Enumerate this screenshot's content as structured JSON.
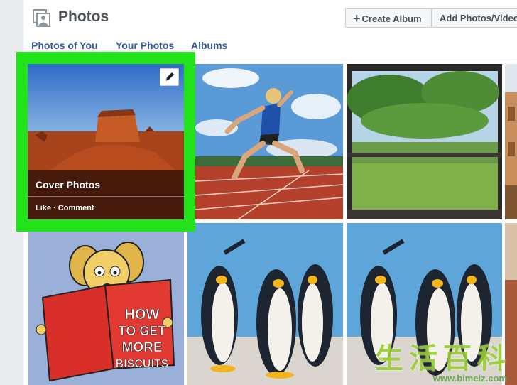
{
  "header": {
    "title": "Photos",
    "photos_icon": "photos-album-icon",
    "create_album_label": "Create Album",
    "add_photos_label": "Add Photos/Video"
  },
  "tabs": [
    {
      "label": "Photos of You"
    },
    {
      "label": "Your Photos"
    },
    {
      "label": "Albums"
    }
  ],
  "cover": {
    "title": "Cover Photos",
    "actions": "Like · Comment",
    "edit_icon": "pencil-icon",
    "highlight_color": "#22e31a"
  },
  "book": {
    "line1": "HOW",
    "line2": "TO GET",
    "line3": "MORE",
    "line4": "BISCUITS"
  },
  "watermark": {
    "text": "生活百科",
    "url": "www.bimeiz.com"
  },
  "colors": {
    "link": "#365899",
    "title": "#4b4f56",
    "page_bg": "#e9ebee"
  }
}
